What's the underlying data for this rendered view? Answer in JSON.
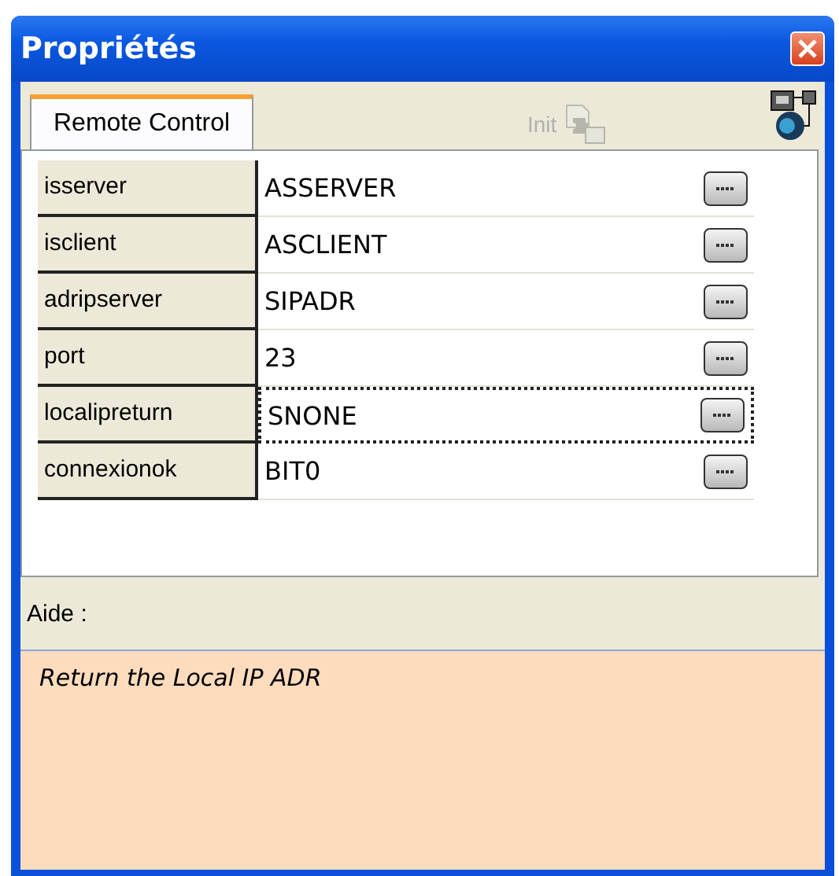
{
  "window": {
    "title": "Propriétés"
  },
  "tabs": [
    {
      "label": "Remote Control",
      "selected": true
    }
  ],
  "toolbar": {
    "init": {
      "label": "Init",
      "disabled": true
    }
  },
  "properties": [
    {
      "name": "isserver",
      "value": "ASSERVER",
      "selected": false
    },
    {
      "name": "isclient",
      "value": "ASCLIENT",
      "selected": false
    },
    {
      "name": "adripserver",
      "value": "SIPADR",
      "selected": false
    },
    {
      "name": "port",
      "value": "23",
      "selected": false
    },
    {
      "name": "localipreturn",
      "value": "SNONE",
      "selected": true
    },
    {
      "name": "connexionok",
      "value": "BIT0",
      "selected": false
    }
  ],
  "help": {
    "label": "Aide :",
    "text": "Return the Local IP ADR"
  }
}
